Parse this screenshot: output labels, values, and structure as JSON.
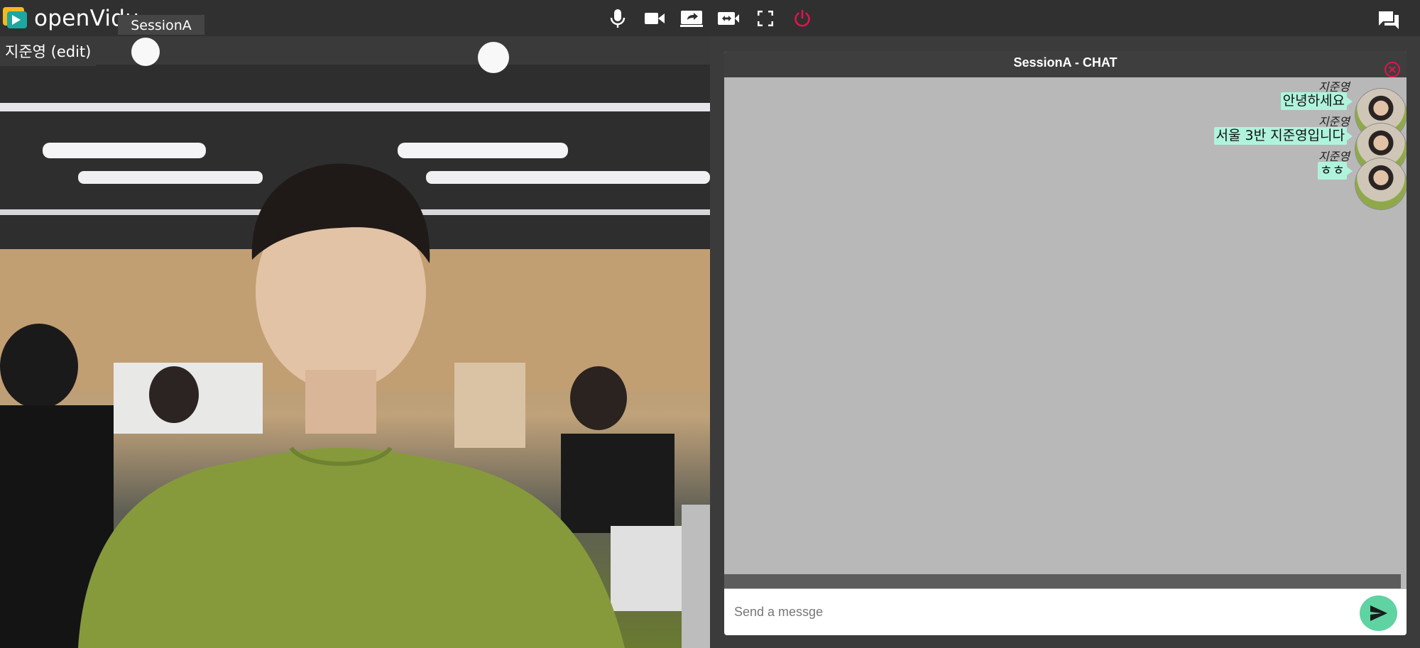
{
  "toolbar": {
    "logo_text": "openVidu",
    "session_name": "SessionA",
    "icons": [
      "microphone-icon",
      "camera-icon",
      "screen-share-icon",
      "switch-camera-icon",
      "fullscreen-icon",
      "leave-session-icon",
      "chat-toggle-icon"
    ],
    "colors": {
      "background": "#303030",
      "leave": "#e0144c",
      "icon": "#ffffff"
    }
  },
  "video": {
    "nickname": "지준영 (edit)"
  },
  "chat": {
    "title": "SessionA - CHAT",
    "messages": [
      {
        "name": "지준영",
        "text": "안녕하세요"
      },
      {
        "name": "지준영",
        "text": "서울 3반 지준영입니다"
      },
      {
        "name": "지준영",
        "text": "ㅎㅎ"
      }
    ],
    "input_placeholder": "Send a messge",
    "colors": {
      "bubble": "#b0f3dd",
      "send": "#5fd3a2",
      "panel": "#b8b8b8",
      "close": "#e0144c"
    }
  }
}
